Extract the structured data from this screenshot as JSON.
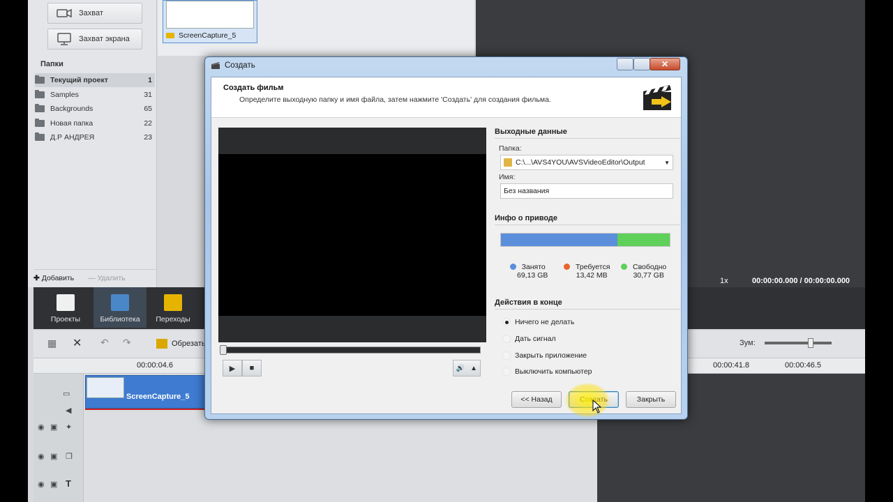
{
  "library": {
    "capture_label": "Захват",
    "screen_capture_label": "Захват экрана",
    "folders_title": "Папки",
    "folders": [
      {
        "name": "Текущий проект",
        "count": "1"
      },
      {
        "name": "Samples",
        "count": "31"
      },
      {
        "name": "Backgrounds",
        "count": "65"
      },
      {
        "name": "Новая папка",
        "count": "22"
      },
      {
        "name": "Д.Р АНДРЕЯ",
        "count": "23"
      }
    ],
    "add_label": "Добавить",
    "delete_label": "Удалить",
    "media_item": "ScreenCapture_5"
  },
  "tabs": [
    {
      "label": "Проекты"
    },
    {
      "label": "Библиотека"
    },
    {
      "label": "Переходы"
    }
  ],
  "timeline": {
    "trim_label": "Обрезать",
    "zoom_label": "Зум:",
    "ruler": [
      "00:00:04.6",
      "00:00:41.8",
      "00:00:46.5"
    ],
    "clip_label": "ScreenCapture_5",
    "speed": "1x",
    "timecode": "00:00:00.000 / 00:00:00.000"
  },
  "dialog": {
    "title": "Создать",
    "header_title": "Создать фильм",
    "header_sub": "Определите выходную папку и имя файла, затем нажмите 'Создать' для создания фильма.",
    "output_section": "Выходные данные",
    "folder_label": "Папка:",
    "folder_value": "C:\\...\\AVS4YOU\\AVSVideoEditor\\Output",
    "name_label": "Имя:",
    "name_value": "Без названия",
    "drive_section": "Инфо о приводе",
    "disk": {
      "used_label": "Занято",
      "used_value": "69,13 GB",
      "required_label": "Требуется",
      "required_value": "13,42 MB",
      "free_label": "Свободно",
      "free_value": "30,77 GB",
      "used_fraction": 0.69
    },
    "actions_section": "Действия в конце",
    "actions": [
      {
        "label": "Ничего не делать",
        "selected": true
      },
      {
        "label": "Дать сигнал",
        "selected": false
      },
      {
        "label": "Закрыть приложение",
        "selected": false
      },
      {
        "label": "Выключить компьютер",
        "selected": false
      }
    ],
    "back_label": "<< Назад",
    "create_label": "Создать",
    "close_label": "Закрыть"
  },
  "colors": {
    "used": "#5b8fdc",
    "required": "#e8652d",
    "free": "#5fd05a"
  }
}
